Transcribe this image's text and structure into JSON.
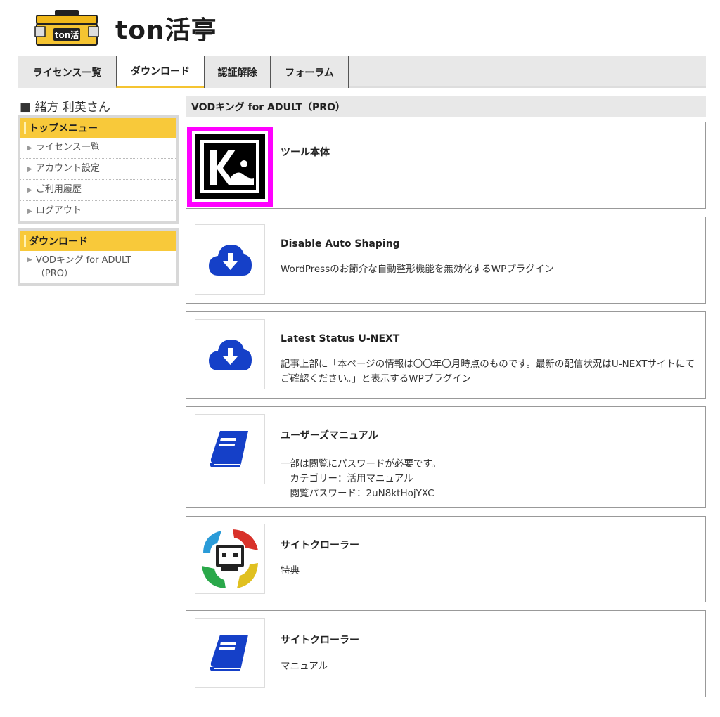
{
  "logo": {
    "text": "ton活亭",
    "badge_text": "ton活"
  },
  "nav": {
    "tabs": [
      {
        "label": "ライセンス一覧"
      },
      {
        "label": "ダウンロード"
      },
      {
        "label": "認証解除"
      },
      {
        "label": "フォーラム"
      }
    ]
  },
  "sidebar": {
    "user_name": "■ 緒方 利英さん",
    "top_menu": {
      "heading": "トップメニュー",
      "items": [
        {
          "label": "ライセンス一覧"
        },
        {
          "label": "アカウント設定"
        },
        {
          "label": "ご利用履歴"
        },
        {
          "label": "ログアウト"
        }
      ]
    },
    "download_menu": {
      "heading": "ダウンロード",
      "items": [
        {
          "label": "VODキング for ADULT\n（PRO）"
        }
      ]
    }
  },
  "main": {
    "title": "VODキング for ADULT（PRO）",
    "cards": [
      {
        "title": "ツール本体",
        "description": "",
        "icon": "vod-king-logo-icon"
      },
      {
        "title": "Disable Auto Shaping",
        "description": "WordPressのお節介な自動整形機能を無効化するWPプラグイン",
        "icon": "cloud-download-icon"
      },
      {
        "title": "Latest Status U-NEXT",
        "description": "記事上部に「本ページの情報は〇〇年〇月時点のものです。最新の配信状況はU-NEXTサイトにてご確認ください。」と表示するWPプラグイン",
        "icon": "cloud-download-icon"
      },
      {
        "title": "ユーザーズマニュアル",
        "description": "一部は閲覧にパスワードが必要です。\n　カテゴリー：活用マニュアル\n　閲覧パスワード：2uN8ktHojYXC",
        "icon": "book-icon"
      },
      {
        "title": "サイトクローラー",
        "description": "特典",
        "icon": "robot-icon"
      },
      {
        "title": "サイトクローラー",
        "description": "マニュアル",
        "icon": "book-icon"
      }
    ]
  },
  "colors": {
    "accent": "#f8c93a",
    "icon_blue": "#1540c8",
    "highlight": "#ff00ff"
  }
}
